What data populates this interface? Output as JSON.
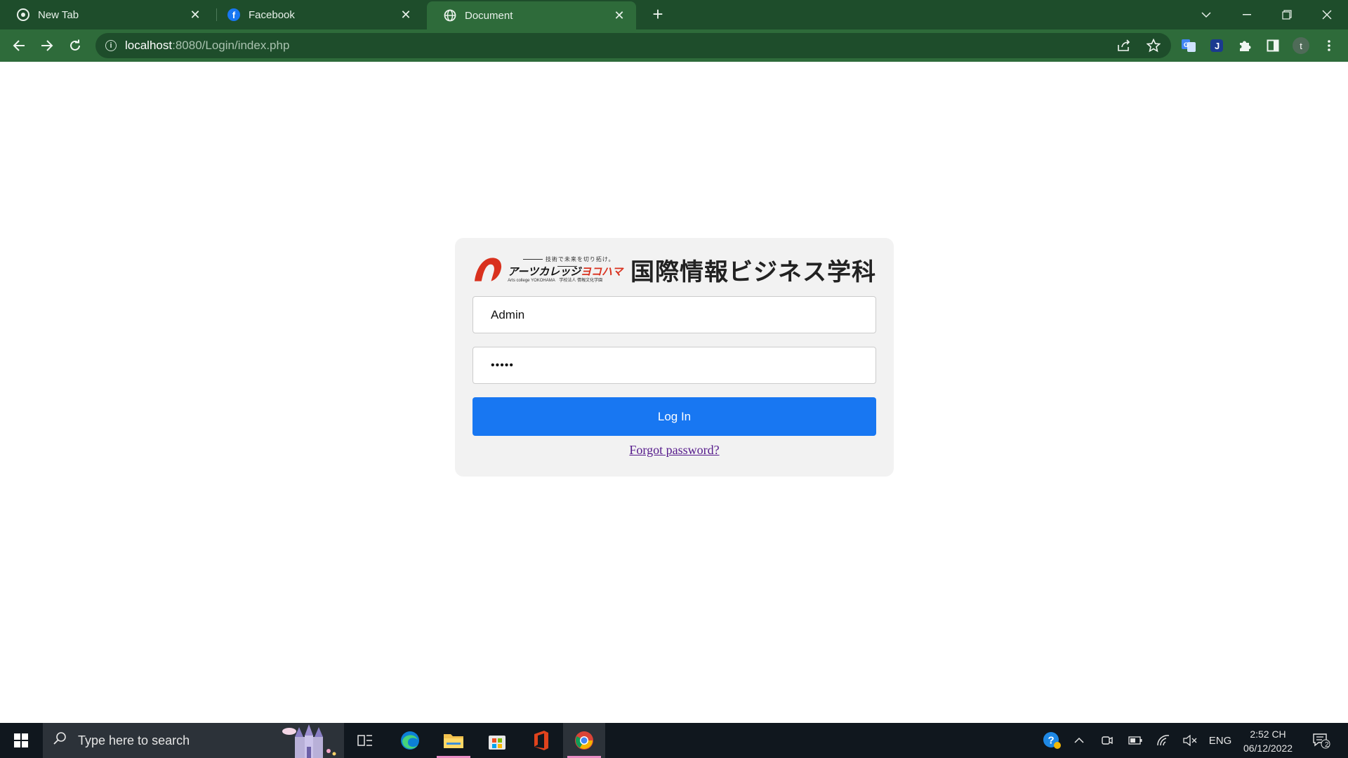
{
  "browser": {
    "tabs": [
      {
        "title": "New Tab",
        "icon": "chrome-icon",
        "active": false
      },
      {
        "title": "Facebook",
        "icon": "facebook-icon",
        "active": false
      },
      {
        "title": "Document",
        "icon": "globe-icon",
        "active": true
      }
    ],
    "new_tab_label": "+",
    "address": {
      "host": "localhost",
      "path": ":8080/Login/index.php"
    },
    "profile_initial": "t"
  },
  "login": {
    "brand": {
      "slogan": "技術で未来を切り拓け。",
      "name_black": "アーツカレッジ",
      "name_red": "ヨコハマ",
      "sub": "Arts college YOKOHAMA　学校法人 情報文化学園"
    },
    "department_title": "国際情報ビジネス学科",
    "username_value": "Admin",
    "password_mask": "•••••",
    "login_button": "Log In",
    "forgot_link": "Forgot password?"
  },
  "taskbar": {
    "search_placeholder": "Type here to search",
    "language": "ENG",
    "time": "2:52 CH",
    "date": "06/12/2022",
    "notification_count": "2"
  },
  "colors": {
    "chrome_dark": "#1e4d2b",
    "chrome_light": "#2e6b3a",
    "primary_button": "#1877f2",
    "brand_red": "#d9311e",
    "card_bg": "#f2f2f2"
  }
}
